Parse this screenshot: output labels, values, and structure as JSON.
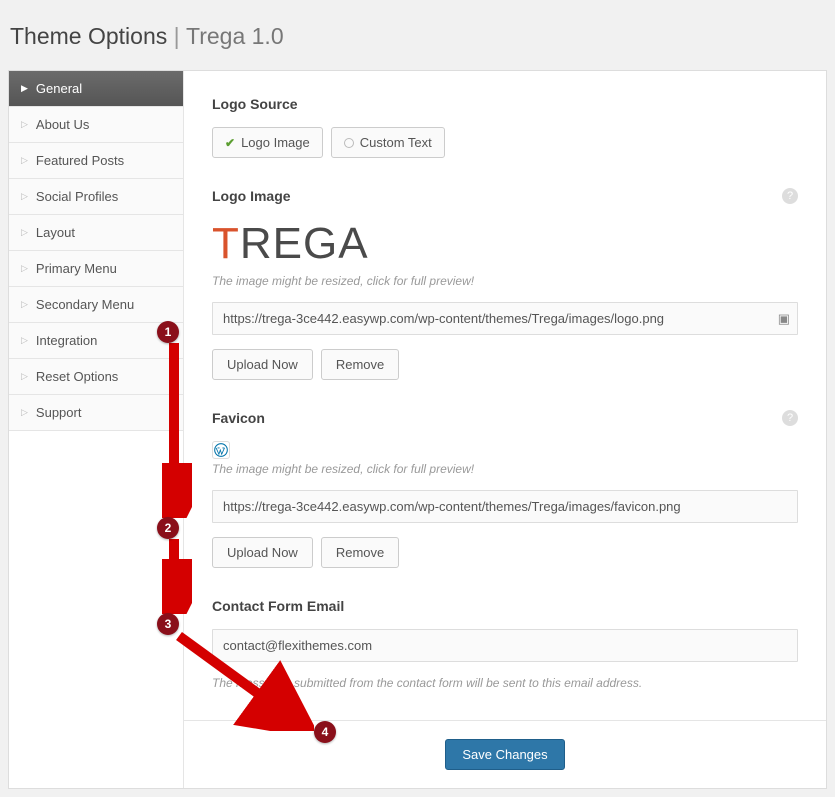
{
  "header": {
    "title": "Theme Options",
    "divider": "|",
    "subtitle": "Trega 1.0"
  },
  "sidebar": {
    "items": [
      {
        "label": "General",
        "active": true
      },
      {
        "label": "About Us",
        "active": false
      },
      {
        "label": "Featured Posts",
        "active": false
      },
      {
        "label": "Social Profiles",
        "active": false
      },
      {
        "label": "Layout",
        "active": false
      },
      {
        "label": "Primary Menu",
        "active": false
      },
      {
        "label": "Secondary Menu",
        "active": false
      },
      {
        "label": "Integration",
        "active": false
      },
      {
        "label": "Reset Options",
        "active": false
      },
      {
        "label": "Support",
        "active": false
      }
    ]
  },
  "sections": {
    "logo_source": {
      "title": "Logo Source",
      "options": {
        "logo_image": "Logo Image",
        "custom_text": "Custom Text"
      }
    },
    "logo_image": {
      "title": "Logo Image",
      "hint": "The image might be resized, click for full preview!",
      "value": "https://trega-3ce442.easywp.com/wp-content/themes/Trega/images/logo.png",
      "upload_label": "Upload Now",
      "remove_label": "Remove"
    },
    "favicon": {
      "title": "Favicon",
      "hint": "The image might be resized, click for full preview!",
      "value": "https://trega-3ce442.easywp.com/wp-content/themes/Trega/images/favicon.png",
      "upload_label": "Upload Now",
      "remove_label": "Remove"
    },
    "contact_email": {
      "title": "Contact Form Email",
      "value": "contact@flexithemes.com",
      "hint": "The messages submitted from the contact form will be sent to this email address."
    }
  },
  "footer": {
    "save_label": "Save Changes"
  },
  "annotations": {
    "b1": "1",
    "b2": "2",
    "b3": "3",
    "b4": "4"
  }
}
